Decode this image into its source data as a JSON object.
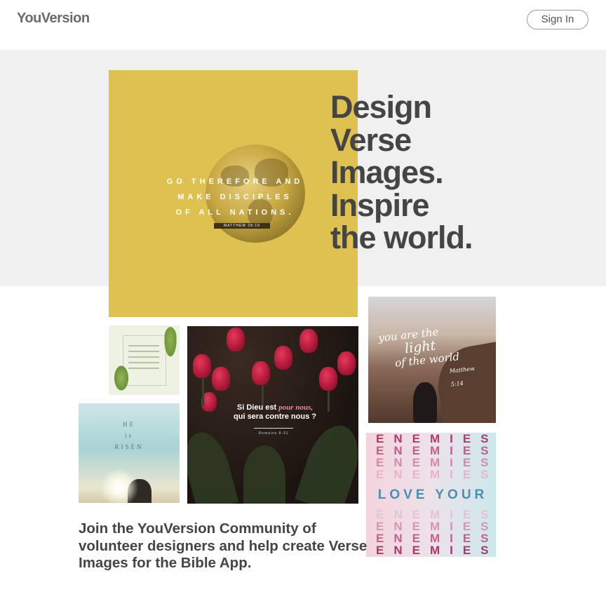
{
  "header": {
    "logo": "YouVersion",
    "sign_in": "Sign In"
  },
  "hero": {
    "headline": [
      "Design",
      "Verse",
      "Images.",
      "Inspire",
      "the world."
    ]
  },
  "images": {
    "globe": {
      "lines": [
        "GO THEREFORE AND",
        "MAKE DISCIPLES",
        "OF ALL NATIONS."
      ],
      "reference": "MATTHEW 28:19"
    },
    "risen": {
      "lines": [
        "HE",
        "is",
        "RISEN"
      ]
    },
    "tulips": {
      "line1_pre": "Si Dieu est ",
      "line1_accent": "pour nous,",
      "line2": "qui sera contre nous ?",
      "reference": "Romains 8:31"
    },
    "light": {
      "lines": [
        "you are the",
        "light",
        "of the world"
      ],
      "reference": "Matthew 5:14"
    },
    "enemies": {
      "word": "ENEMIES",
      "love": "LOVE YOUR"
    }
  },
  "community": {
    "text": "Join the YouVersion Community of volunteer designers and help create Verse Images for the Bible App."
  },
  "colors": {
    "hero_band": "#f0f0f0",
    "globe_bg": "#dfc152",
    "headline": "#454545",
    "love_blue": "#4a8fb0"
  }
}
